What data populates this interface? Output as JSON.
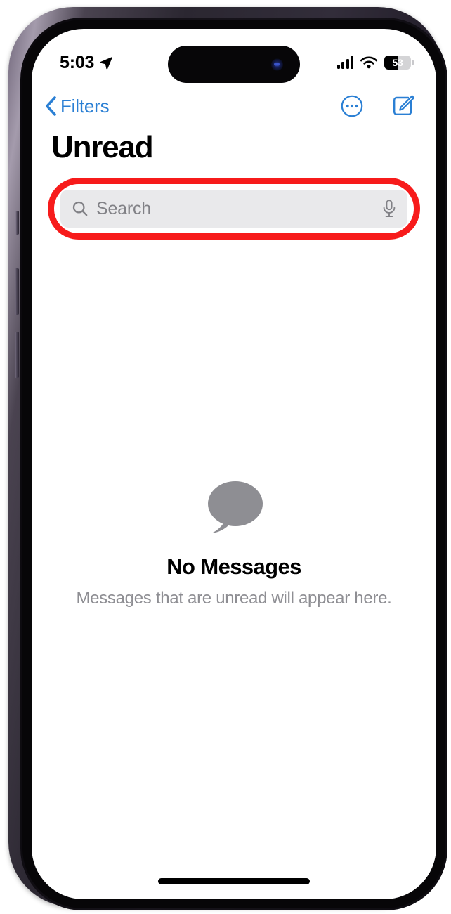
{
  "device": {
    "name": "iphone-14-pro",
    "frame_color": "#3a3442",
    "screen_background": "#ffffff"
  },
  "status_bar": {
    "time": "5:03",
    "location_icon": "location-arrow-icon",
    "signal_icon": "cellular-signal-icon",
    "signal_bars": 4,
    "wifi_icon": "wifi-icon",
    "battery_percent": "53",
    "battery_level": 53,
    "battery_icon": "battery-icon"
  },
  "nav_bar": {
    "back_icon": "chevron-left-icon",
    "back_label": "Filters",
    "more_icon": "more-circle-icon",
    "compose_icon": "compose-icon",
    "tint_color": "#2a7fd4"
  },
  "header": {
    "title": "Unread"
  },
  "search": {
    "placeholder": "Search",
    "value": "",
    "search_icon": "search-icon",
    "mic_icon": "microphone-icon",
    "field_background": "#e9e9eb",
    "highlight_color": "#f71b1b"
  },
  "empty_state": {
    "icon": "message-bubble-icon",
    "icon_color": "#8e8e93",
    "title": "No Messages",
    "subtitle": "Messages that are unread will appear here."
  },
  "home_indicator": {
    "label": "home-indicator"
  }
}
